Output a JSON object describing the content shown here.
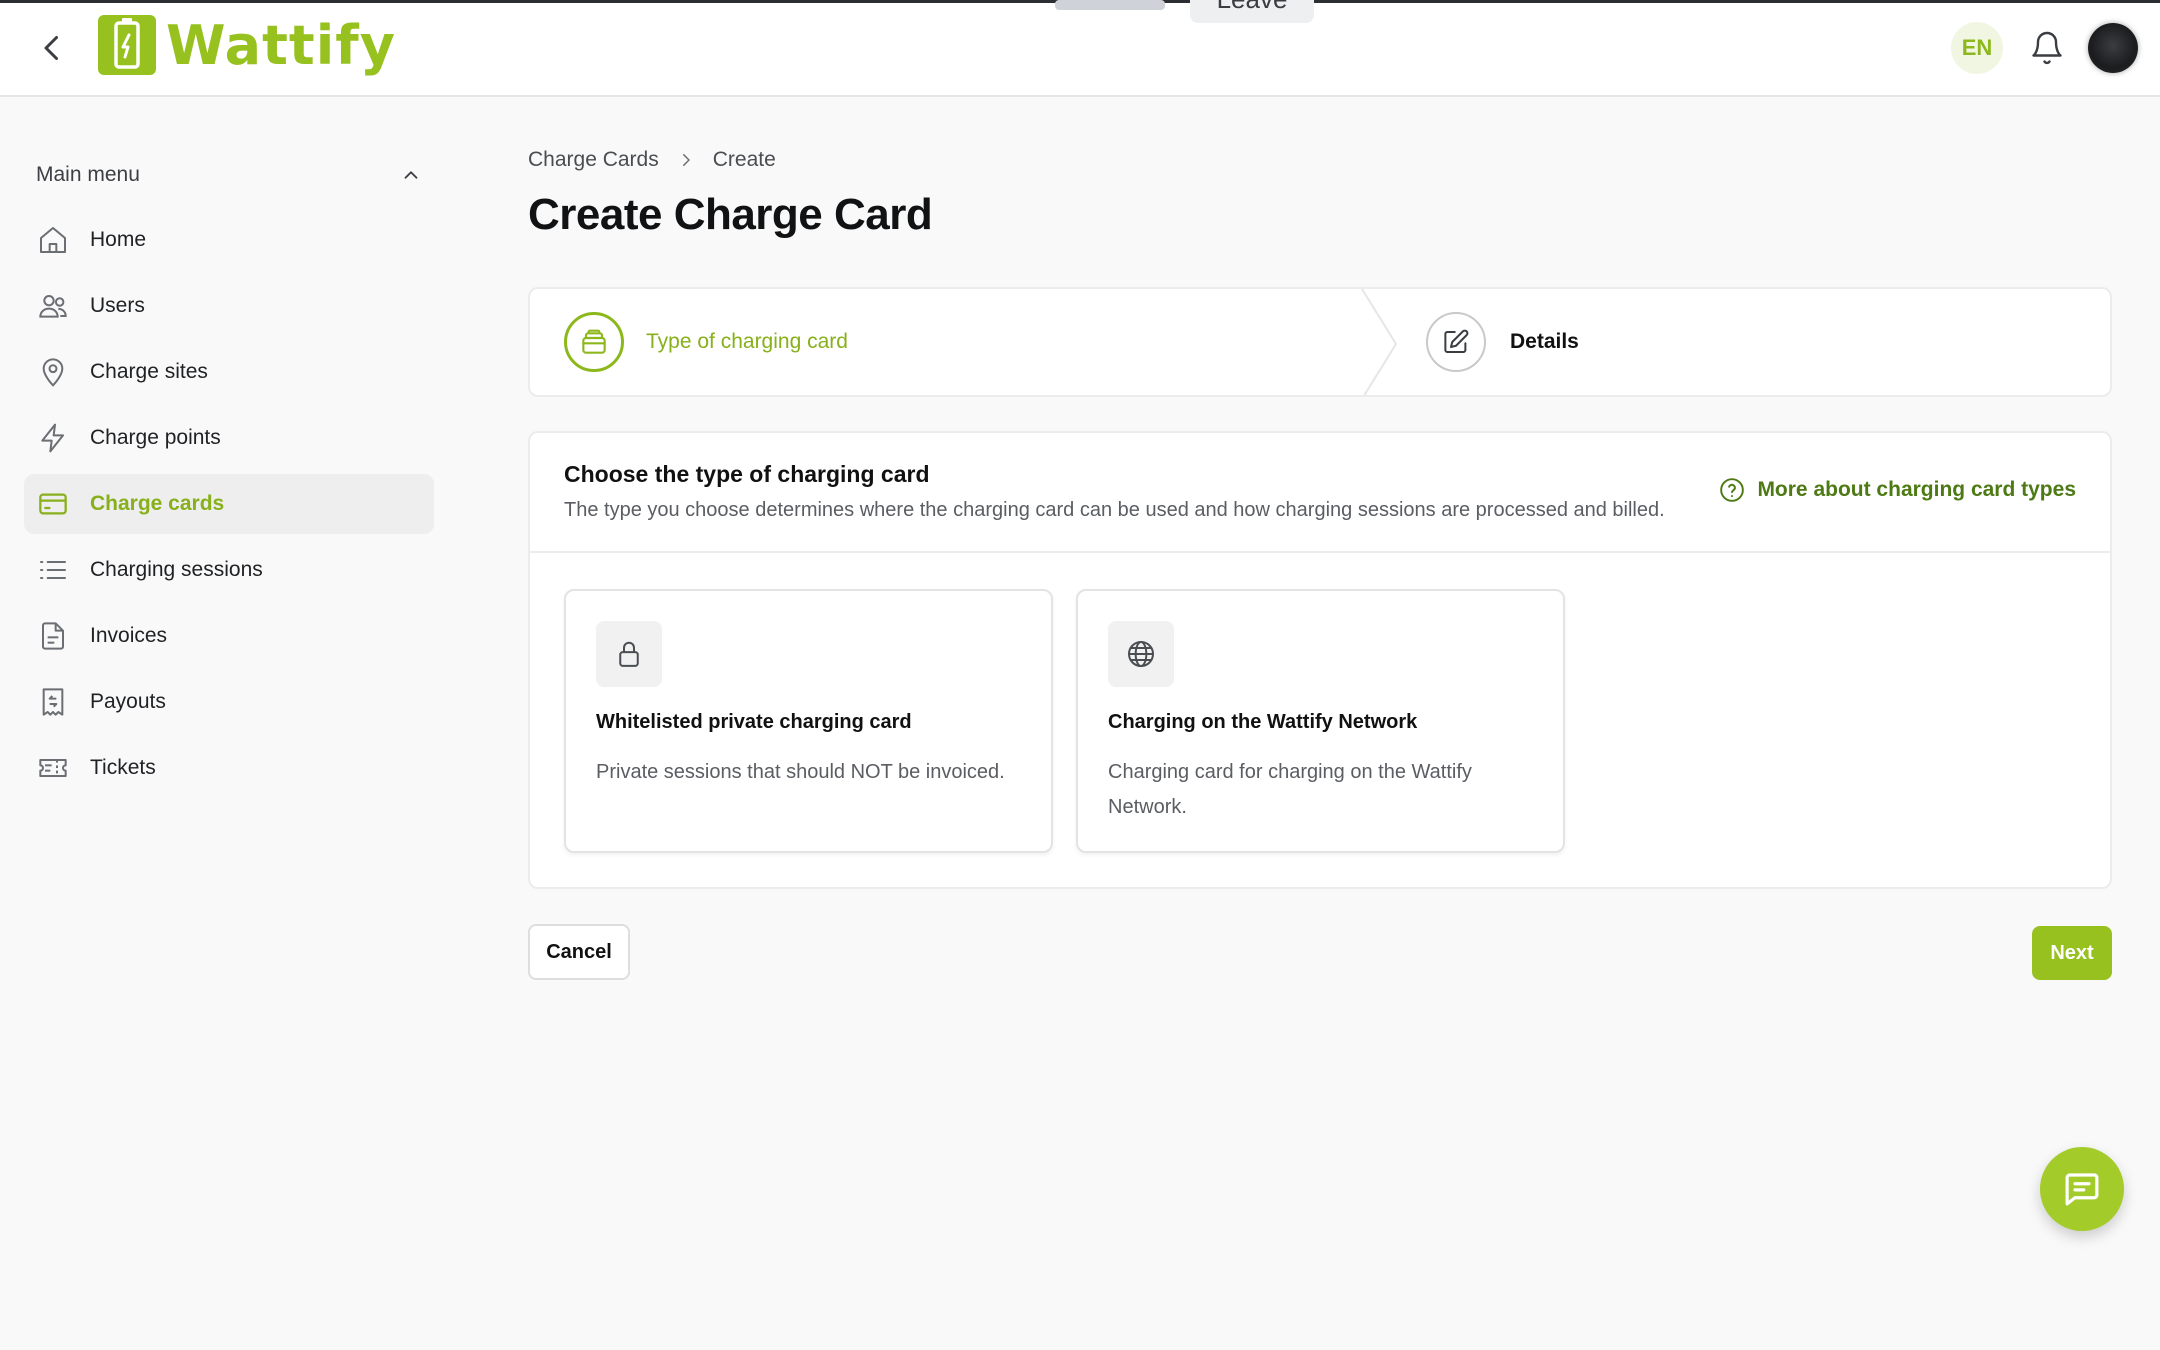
{
  "topbar": {
    "share_text": "",
    "leave_label": "Leave",
    "brand": "Wattify",
    "language": "EN"
  },
  "icons": {
    "back": "chevron-left-icon",
    "notifications": "bell-icon",
    "chat": "chat-bubble-icon"
  },
  "sidebar": {
    "menu_title": "Main menu",
    "items": [
      {
        "label": "Home",
        "icon": "home-icon"
      },
      {
        "label": "Users",
        "icon": "users-icon"
      },
      {
        "label": "Charge sites",
        "icon": "map-pin-icon"
      },
      {
        "label": "Charge points",
        "icon": "lightning-icon"
      },
      {
        "label": "Charge cards",
        "icon": "credit-card-icon",
        "active": true
      },
      {
        "label": "Charging sessions",
        "icon": "list-icon"
      },
      {
        "label": "Invoices",
        "icon": "document-icon"
      },
      {
        "label": "Payouts",
        "icon": "receipt-icon"
      },
      {
        "label": "Tickets",
        "icon": "ticket-icon"
      }
    ]
  },
  "main": {
    "breadcrumb": [
      "Charge Cards",
      "Create"
    ],
    "title": "Create Charge Card",
    "steps": [
      {
        "label": "Type of charging card",
        "icon": "card-stack-icon",
        "state": "current"
      },
      {
        "label": "Details",
        "icon": "pencil-edit-icon",
        "state": "upcoming"
      }
    ],
    "card": {
      "title": "Choose the type of charging card",
      "subtitle": "The type you choose determines where the charging card can be used and how charging sessions are processed and billed.",
      "more_link": "More about charging card types",
      "options": [
        {
          "title": "Whitelisted private charging card",
          "description": "Private sessions that should NOT be invoiced.",
          "icon": "lock-icon"
        },
        {
          "title": "Charging on the Wattify Network",
          "description": "Charging card for charging on the Wattify Network.",
          "icon": "globe-icon"
        }
      ]
    },
    "cancel_label": "Cancel",
    "next_label": "Next"
  },
  "colors": {
    "accent": "#97c11f",
    "accent_text": "#87b01a",
    "link": "#4d7a14"
  }
}
